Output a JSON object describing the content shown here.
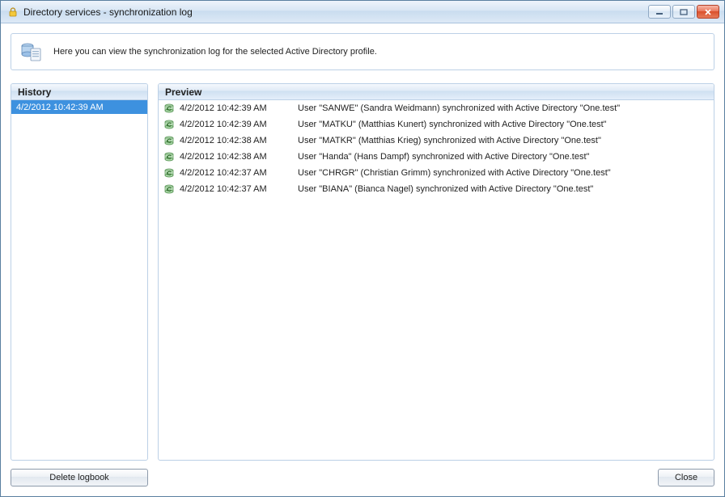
{
  "window": {
    "title": "Directory services - synchronization log"
  },
  "info": {
    "text": "Here you can view the synchronization log for the selected Active Directory profile."
  },
  "panels": {
    "history": {
      "title": "History",
      "items": [
        {
          "label": "4/2/2012 10:42:39 AM",
          "selected": true
        }
      ]
    },
    "preview": {
      "title": "Preview",
      "rows": [
        {
          "time": "4/2/2012 10:42:39 AM",
          "message": "User \"SANWE\" (Sandra Weidmann) synchronized with Active Directory \"One.test\""
        },
        {
          "time": "4/2/2012 10:42:39 AM",
          "message": "User \"MATKU\" (Matthias Kunert) synchronized with Active Directory \"One.test\""
        },
        {
          "time": "4/2/2012 10:42:38 AM",
          "message": "User \"MATKR\" (Matthias Krieg) synchronized with Active Directory \"One.test\""
        },
        {
          "time": "4/2/2012 10:42:38 AM",
          "message": "User \"Handa\" (Hans Dampf) synchronized with Active Directory \"One.test\""
        },
        {
          "time": "4/2/2012 10:42:37 AM",
          "message": "User \"CHRGR\" (Christian Grimm) synchronized with Active Directory \"One.test\""
        },
        {
          "time": "4/2/2012 10:42:37 AM",
          "message": "User \"BIANA\" (Bianca Nagel) synchronized with Active Directory \"One.test\""
        }
      ]
    }
  },
  "buttons": {
    "delete": "Delete logbook",
    "close": "Close"
  }
}
